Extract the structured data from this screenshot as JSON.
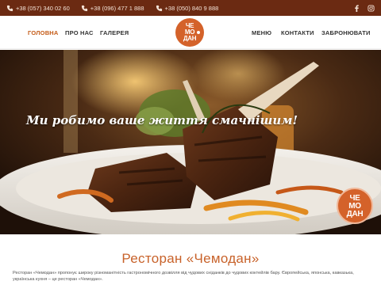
{
  "topbar": {
    "phones": [
      "+38 (057) 340 02 60",
      "+38 (096) 477 1 888",
      "+38 (050) 840 9 888"
    ],
    "social": [
      "facebook-icon",
      "instagram-icon"
    ]
  },
  "nav": {
    "left": [
      "ГОЛОВНА",
      "ПРО НАС",
      "ГАЛЕРЕЯ"
    ],
    "right": [
      "МЕНЮ",
      "КОНТАКТИ",
      "ЗАБРОНЮВАТИ"
    ],
    "active": "ГОЛОВНА"
  },
  "logo": {
    "line1": "ЧЕ",
    "line2": "МО",
    "line3": "ДАН"
  },
  "hero": {
    "tagline": "Ми робимо ваше життя смачнішим!"
  },
  "badge": {
    "line1": "ЧЕ",
    "line2": "МО",
    "line3": "ДАН"
  },
  "content": {
    "title": "Ресторан «Чемодан»",
    "description": "Ресторан «Чемодан» пропонує широку різноманітність гастрономічного дозвілля від чудових сніданків до чудових коктейлів бару. Європейська, японська, кавказька, українська кухня – це ресторан «Чемодан»."
  },
  "colors": {
    "topbar": "#6b2a12",
    "accent": "#c45a16",
    "brand": "#d4622a"
  }
}
